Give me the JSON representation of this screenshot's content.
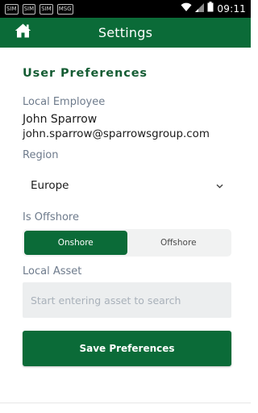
{
  "status_bar": {
    "time": "09:11",
    "notifications": [
      "SIM",
      "SIM",
      "SIM",
      "MSG"
    ],
    "icons": [
      "wifi-icon",
      "signal-icon",
      "battery-icon"
    ]
  },
  "app_bar": {
    "title": "Settings",
    "home_icon": "home-icon"
  },
  "preferences": {
    "heading": "User Preferences",
    "employee_label": "Local Employee",
    "employee_name": "John Sparrow",
    "employee_email": "john.sparrow@sparrowsgroup.com",
    "region_label": "Region",
    "region_value": "Europe",
    "offshore_label": "Is Offshore",
    "offshore_options": [
      "Onshore",
      "Offshore"
    ],
    "offshore_selected": "Onshore",
    "asset_label": "Local Asset",
    "asset_placeholder": "Start entering asset to search",
    "asset_value": "",
    "save_label": "Save Preferences"
  },
  "colors": {
    "brand_green": "#0b6b38",
    "heading_green": "#145c33",
    "label_gray": "#6e7b8c"
  }
}
